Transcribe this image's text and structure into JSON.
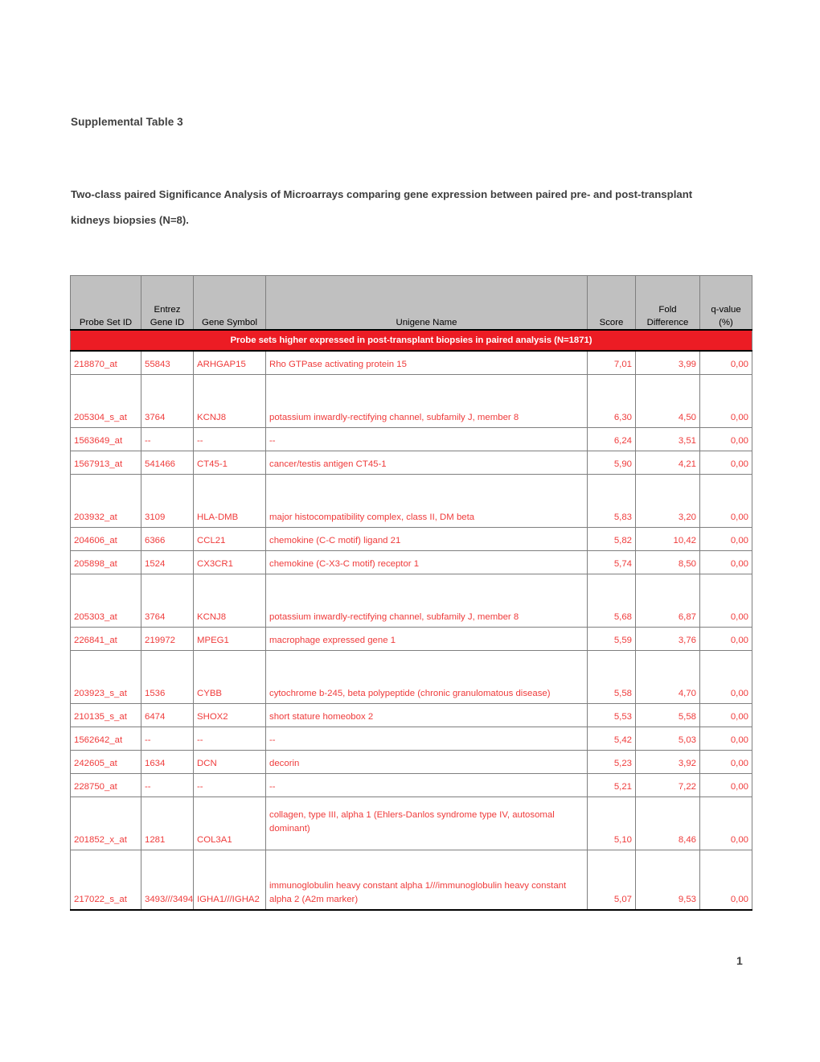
{
  "document": {
    "title": "Supplemental Table 3",
    "abstract_line1": "Two-class paired Significance Analysis of Microarrays comparing gene expression between paired pre- and post-transplant",
    "abstract_line2": "kidneys biopsies (N=8).",
    "page_number": "1"
  },
  "colors": {
    "header_bg": "#c0c0c0",
    "section_bg": "#ec1c24",
    "data_text": "#ef3b3b",
    "title_text": "#3f3f3f",
    "border": "#7f7f7f"
  },
  "table": {
    "columns": [
      {
        "key": "probe_set_id",
        "label": "Probe Set ID"
      },
      {
        "key": "entrez_gene_id",
        "label": "Entrez\nGene ID"
      },
      {
        "key": "gene_symbol",
        "label": "Gene Symbol"
      },
      {
        "key": "unigene_name",
        "label": "Unigene Name"
      },
      {
        "key": "score",
        "label": "Score"
      },
      {
        "key": "fold_difference",
        "label": "Fold\nDifference"
      },
      {
        "key": "q_value",
        "label": "q-value\n(%)"
      }
    ],
    "section_label": "Probe sets higher expressed in post-transplant biopsies in paired analysis (N=1871)",
    "rows": [
      {
        "probe_set_id": "218870_at",
        "entrez_gene_id": "55843",
        "gene_symbol": "ARHGAP15",
        "unigene_name": "Rho GTPase activating protein 15",
        "score": "7,01",
        "fold_difference": "3,99",
        "q_value": "0,00"
      },
      {
        "probe_set_id": "205304_s_at",
        "entrez_gene_id": "3764",
        "gene_symbol": "KCNJ8",
        "unigene_name": "potassium inwardly-rectifying channel, subfamily J, member 8",
        "score": "6,30",
        "fold_difference": "4,50",
        "q_value": "0,00"
      },
      {
        "probe_set_id": "1563649_at",
        "entrez_gene_id": "--",
        "gene_symbol": "--",
        "unigene_name": "--",
        "score": "6,24",
        "fold_difference": "3,51",
        "q_value": "0,00"
      },
      {
        "probe_set_id": "1567913_at",
        "entrez_gene_id": "541466",
        "gene_symbol": "CT45-1",
        "unigene_name": "cancer/testis antigen CT45-1",
        "score": "5,90",
        "fold_difference": "4,21",
        "q_value": "0,00"
      },
      {
        "probe_set_id": "203932_at",
        "entrez_gene_id": "3109",
        "gene_symbol": "HLA-DMB",
        "unigene_name": "major histocompatibility complex, class II, DM beta",
        "score": "5,83",
        "fold_difference": "3,20",
        "q_value": "0,00"
      },
      {
        "probe_set_id": "204606_at",
        "entrez_gene_id": "6366",
        "gene_symbol": "CCL21",
        "unigene_name": "chemokine (C-C motif) ligand 21",
        "score": "5,82",
        "fold_difference": "10,42",
        "q_value": "0,00"
      },
      {
        "probe_set_id": "205898_at",
        "entrez_gene_id": "1524",
        "gene_symbol": "CX3CR1",
        "unigene_name": "chemokine (C-X3-C motif) receptor 1",
        "score": "5,74",
        "fold_difference": "8,50",
        "q_value": "0,00"
      },
      {
        "probe_set_id": "205303_at",
        "entrez_gene_id": "3764",
        "gene_symbol": "KCNJ8",
        "unigene_name": "potassium inwardly-rectifying channel, subfamily J, member 8",
        "score": "5,68",
        "fold_difference": "6,87",
        "q_value": "0,00"
      },
      {
        "probe_set_id": "226841_at",
        "entrez_gene_id": "219972",
        "gene_symbol": "MPEG1",
        "unigene_name": "macrophage expressed gene 1",
        "score": "5,59",
        "fold_difference": "3,76",
        "q_value": "0,00"
      },
      {
        "probe_set_id": "203923_s_at",
        "entrez_gene_id": "1536",
        "gene_symbol": "CYBB",
        "unigene_name": "cytochrome b-245, beta polypeptide (chronic granulomatous disease)",
        "score": "5,58",
        "fold_difference": "4,70",
        "q_value": "0,00"
      },
      {
        "probe_set_id": "210135_s_at",
        "entrez_gene_id": "6474",
        "gene_symbol": "SHOX2",
        "unigene_name": "short stature homeobox 2",
        "score": "5,53",
        "fold_difference": "5,58",
        "q_value": "0,00"
      },
      {
        "probe_set_id": "1562642_at",
        "entrez_gene_id": "--",
        "gene_symbol": "--",
        "unigene_name": "--",
        "score": "5,42",
        "fold_difference": "5,03",
        "q_value": "0,00"
      },
      {
        "probe_set_id": "242605_at",
        "entrez_gene_id": "1634",
        "gene_symbol": "DCN",
        "unigene_name": "decorin",
        "score": "5,23",
        "fold_difference": "3,92",
        "q_value": "0,00"
      },
      {
        "probe_set_id": "228750_at",
        "entrez_gene_id": "--",
        "gene_symbol": "--",
        "unigene_name": "--",
        "score": "5,21",
        "fold_difference": "7,22",
        "q_value": "0,00"
      },
      {
        "probe_set_id": "201852_x_at",
        "entrez_gene_id": "1281",
        "gene_symbol": "COL3A1",
        "unigene_name": "collagen, type III, alpha 1 (Ehlers-Danlos syndrome type IV, autosomal dominant)",
        "score": "5,10",
        "fold_difference": "8,46",
        "q_value": "0,00"
      },
      {
        "probe_set_id": "217022_s_at",
        "entrez_gene_id": "3493///3494",
        "gene_symbol": "IGHA1///IGHA2",
        "unigene_name": "immunoglobulin heavy constant alpha 1///immunoglobulin heavy constant alpha 2 (A2m marker)",
        "score": "5,07",
        "fold_difference": "9,53",
        "q_value": "0,00"
      }
    ]
  }
}
